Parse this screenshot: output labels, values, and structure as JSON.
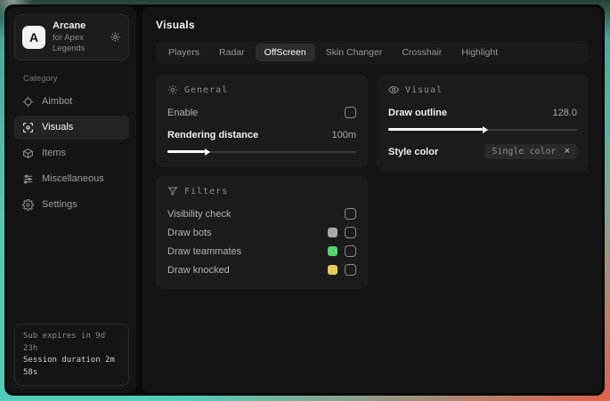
{
  "app": {
    "logo_letter": "A",
    "title": "Arcane",
    "subtitle": "for Apex Legends"
  },
  "sidebar": {
    "category_label": "Category",
    "items": [
      {
        "label": "Aimbot",
        "icon": "crosshair-icon",
        "active": false
      },
      {
        "label": "Visuals",
        "icon": "eye-scan-icon",
        "active": true
      },
      {
        "label": "Items",
        "icon": "box-icon",
        "active": false
      },
      {
        "label": "Miscellaneous",
        "icon": "sliders-icon",
        "active": false
      },
      {
        "label": "Settings",
        "icon": "gear-icon",
        "active": false
      }
    ],
    "footer": {
      "sub_expires": "Sub expires in 9d 23h",
      "session_duration": "Session duration 2m 58s"
    }
  },
  "main": {
    "title": "Visuals",
    "tabs": [
      {
        "label": "Players",
        "active": false
      },
      {
        "label": "Radar",
        "active": false
      },
      {
        "label": "OffScreen",
        "active": true
      },
      {
        "label": "Skin Changer",
        "active": false
      },
      {
        "label": "Crosshair",
        "active": false
      },
      {
        "label": "Highlight",
        "active": false
      }
    ],
    "panels": {
      "general": {
        "title": "General",
        "enable_label": "Enable",
        "enable_checked": false,
        "distance_label": "Rendering distance",
        "distance_value": "100m",
        "distance_fill": "20%"
      },
      "filters": {
        "title": "Filters",
        "rows": [
          {
            "label": "Visibility check",
            "swatch": null,
            "checked": false
          },
          {
            "label": "Draw bots",
            "swatch": "#a8a8a8",
            "checked": false
          },
          {
            "label": "Draw teammates",
            "swatch": "#55d46e",
            "checked": false
          },
          {
            "label": "Draw knocked",
            "swatch": "#e6cc5a",
            "checked": false
          }
        ]
      },
      "visual": {
        "title": "Visual",
        "outline_label": "Draw outline",
        "outline_value": "128.0",
        "outline_fill": "50%",
        "style_label": "Style color",
        "style_value": "Single color",
        "style_remove": "×"
      }
    }
  }
}
